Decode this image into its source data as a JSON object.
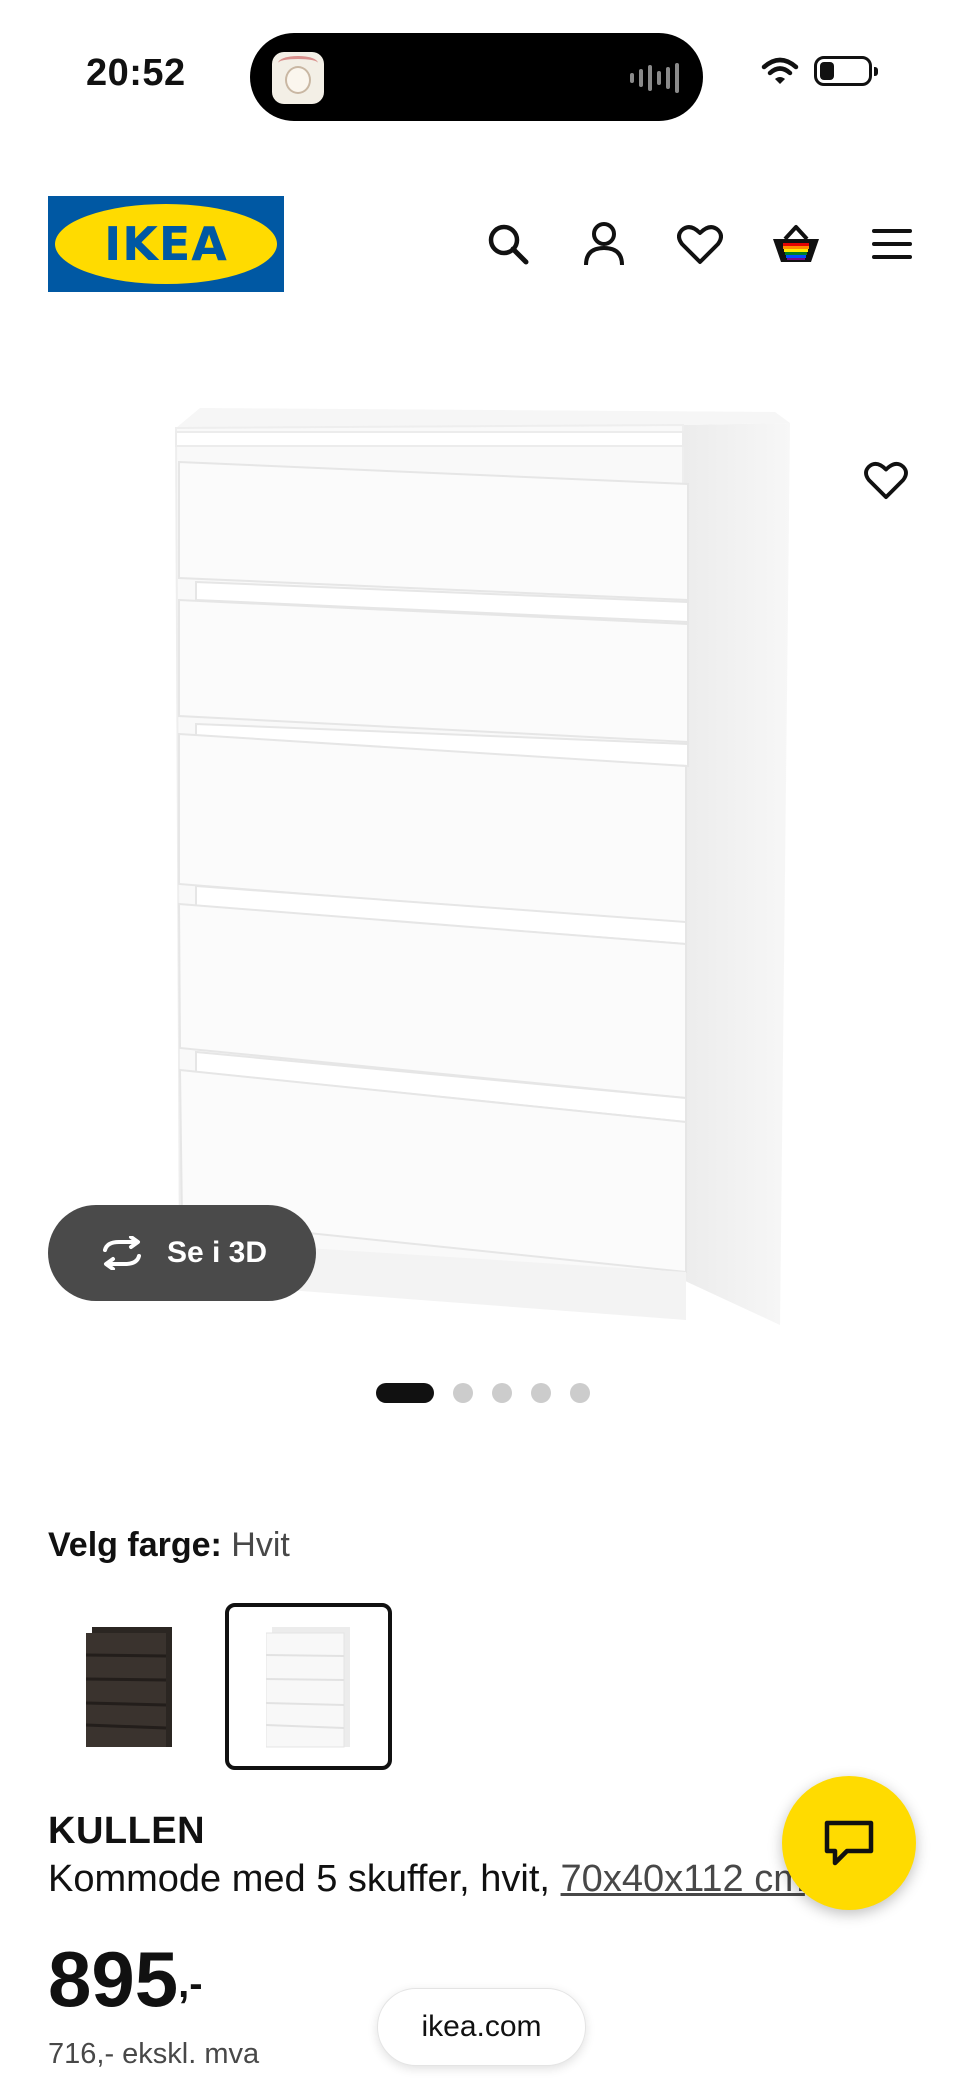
{
  "status_bar": {
    "time": "20:52"
  },
  "header": {
    "logo_text": "IKEA",
    "icons": [
      "search-icon",
      "user-icon",
      "heart-icon",
      "basket-icon",
      "menu-icon"
    ]
  },
  "product_gallery": {
    "view_3d_label": "Se i 3D",
    "slide_count": 5,
    "active_slide": 1
  },
  "color_picker": {
    "label": "Velg farge:",
    "selected": "Hvit",
    "options": [
      {
        "name": "black-brown",
        "color": "#2b2622"
      },
      {
        "name": "white",
        "color": "#ffffff",
        "selected": true
      }
    ]
  },
  "product": {
    "name": "KULLEN",
    "description": "Kommode med 5 skuffer, hvit,",
    "dimensions": "70x40x112 cm",
    "price": "895",
    "price_suffix": ",-",
    "price_ex_vat": "716,- ekskl. mva"
  },
  "browser": {
    "url": "ikea.com"
  },
  "colors": {
    "ikea_blue": "#0058a3",
    "ikea_yellow": "#ffdb00",
    "dark_pill": "#4a4a4a"
  }
}
